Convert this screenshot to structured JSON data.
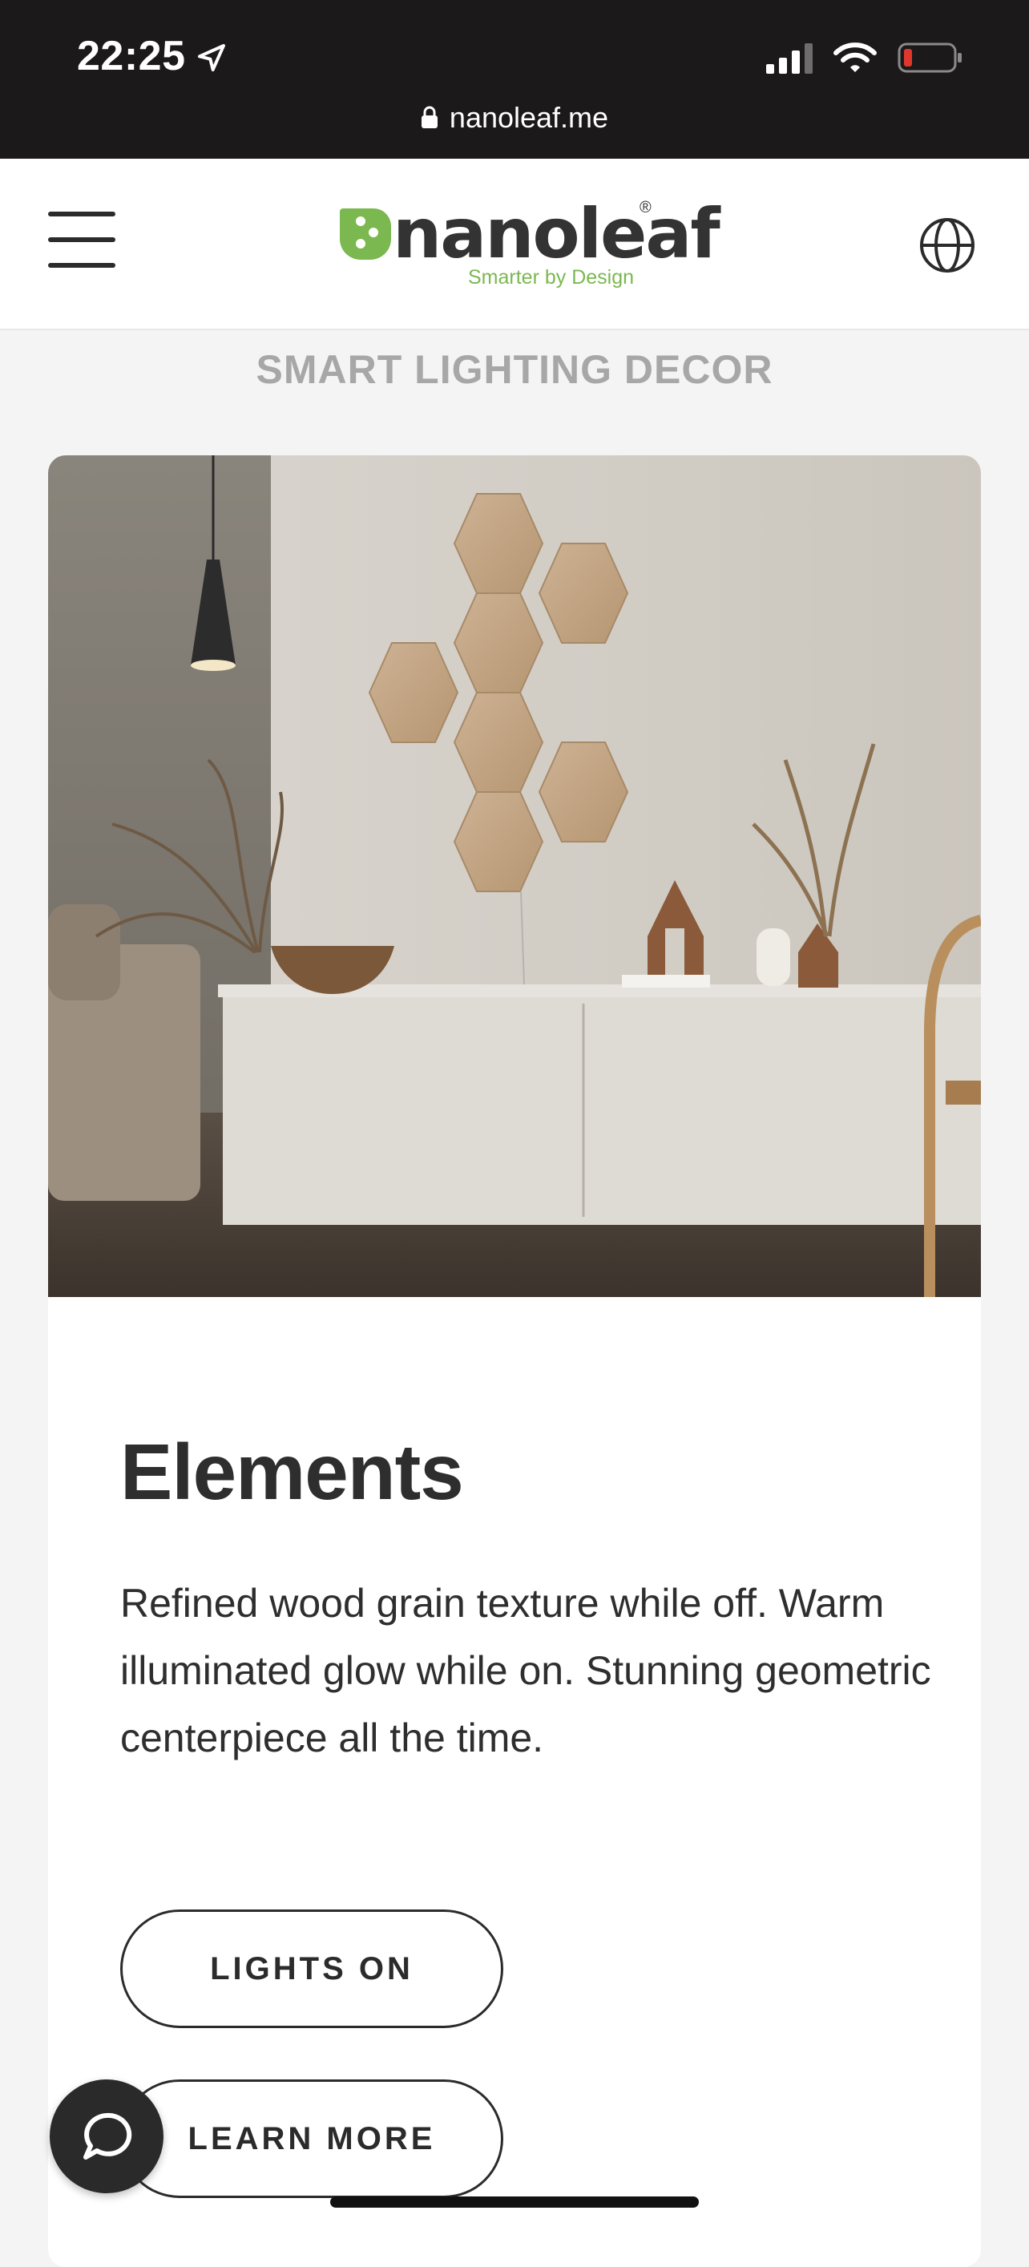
{
  "status_bar": {
    "time": "22:25",
    "url": "nanoleaf.me",
    "battery_color": "#e0372d"
  },
  "header": {
    "brand": "nanoleaf",
    "tagline": "Smarter by Design",
    "brand_color": "#7bb850",
    "menu_icon": "hamburger-icon",
    "language_icon": "globe-icon"
  },
  "section": {
    "title": "SMART LIGHTING DECOR"
  },
  "card": {
    "title": "Elements",
    "description": "Refined wood grain texture while off. Warm illuminated glow while on. Stunning geometric centerpiece all the time.",
    "buttons": {
      "lights_on": "LIGHTS ON",
      "learn_more": "LEARN MORE"
    }
  },
  "chat": {
    "icon": "chat-bubble-icon"
  }
}
